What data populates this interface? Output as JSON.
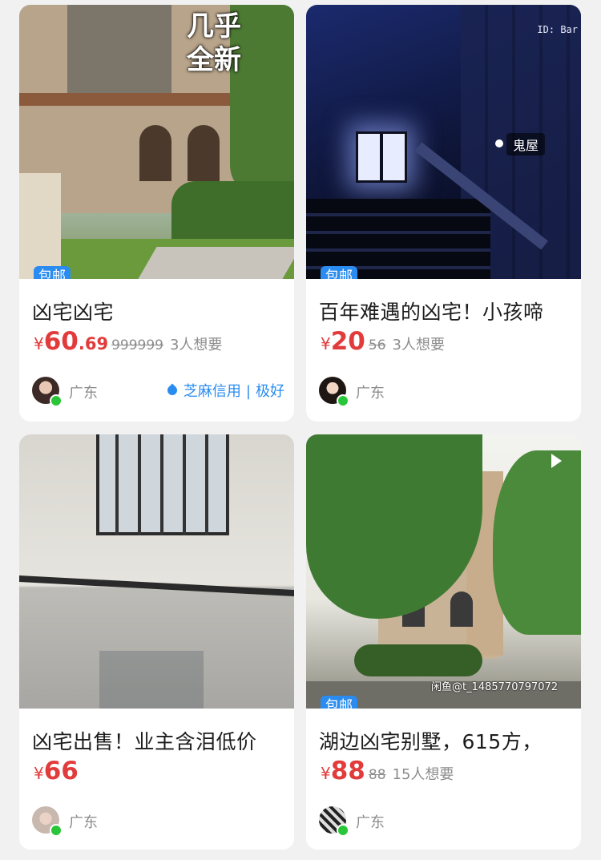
{
  "cards": [
    {
      "badge": "包邮",
      "title": "凶宅凶宅",
      "price_symbol": "¥",
      "price_int": "60",
      "price_dec": ".69",
      "original_price": "999999",
      "want": "3人想要",
      "location": "广东",
      "credit": {
        "label": "芝麻信用",
        "sep": "|",
        "level": "极好"
      },
      "overlay": {
        "line1": "几乎",
        "line2": "全新"
      }
    },
    {
      "badge": "包邮",
      "title": "百年难遇的凶宅！小孩啼",
      "price_symbol": "¥",
      "price_int": "20",
      "price_dec": "",
      "original_price": "56",
      "want": "3人想要",
      "location": "广东",
      "overlay": {
        "label": "鬼屋",
        "id_text": "ID: Bar"
      }
    },
    {
      "title": "凶宅出售！业主含泪低价",
      "price_symbol": "¥",
      "price_int": "66",
      "price_dec": "",
      "location": "广东"
    },
    {
      "badge": "包邮",
      "title": "湖边凶宅别墅，615方，",
      "price_symbol": "¥",
      "price_int": "88",
      "price_dec": "",
      "original_price": "88",
      "want": "15人想要",
      "location": "广东",
      "overlay": {
        "watermark": "闲鱼@t_1485770797072",
        "icon": "play-icon"
      }
    }
  ],
  "colors": {
    "price": "#e23b3b",
    "badge": "#2a8cf0",
    "online": "#29c63a",
    "credit": "#2a8cf0"
  }
}
